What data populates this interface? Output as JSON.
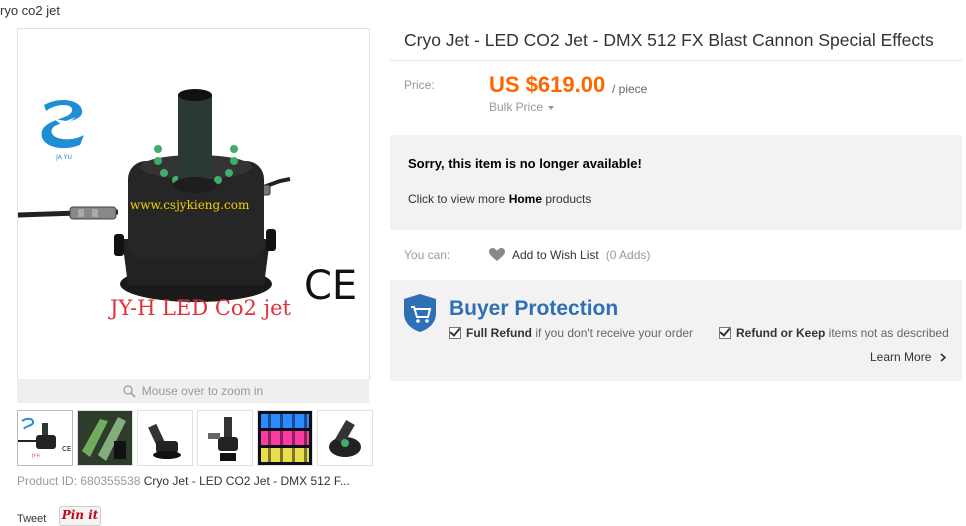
{
  "breadcrumb": "ryo co2 jet",
  "gallery": {
    "main_watermark": "www.csjykieng.com",
    "main_caption": "JY-H LED Co2 jet",
    "ce_mark": "CE",
    "zoom_hint": "Mouse over to zoom in",
    "thumbnails": [
      "co2-jet-thumb",
      "led-jet-beams-thumb",
      "jet-side-view-thumb",
      "jet-clamp-thumb",
      "led-color-grid-thumb",
      "jet-top-view-thumb"
    ]
  },
  "product_id_label": "Product ID: 680355538",
  "product_id_title": "Cryo Jet - LED CO2 Jet - DMX 512 F...",
  "social": {
    "tweet": "Tweet",
    "pinit": "Pin it"
  },
  "product": {
    "title": "Cryo Jet - LED CO2 Jet - DMX 512 FX Blast Cannon Special Effects",
    "price_label": "Price:",
    "price": "US $619.00",
    "unit": "/ piece",
    "bulk_price": "Bulk Price"
  },
  "notice": {
    "heading": "Sorry, this item is no longer available!",
    "text_before": "Click to view more ",
    "text_bold": "Home",
    "text_after": " products"
  },
  "wishlist": {
    "label": "You can:",
    "action": "Add to Wish List",
    "count": "(0 Adds)"
  },
  "buyer_protection": {
    "title": "Buyer Protection",
    "item1_bold": "Full Refund",
    "item1_text": " if you don't receive your order",
    "item2_bold": "Refund or Keep",
    "item2_text": " items not as described",
    "learn_more": "Learn More"
  },
  "colors": {
    "price": "#ff6600",
    "protection": "#2f6fb6",
    "panel": "#f2f2f2"
  }
}
